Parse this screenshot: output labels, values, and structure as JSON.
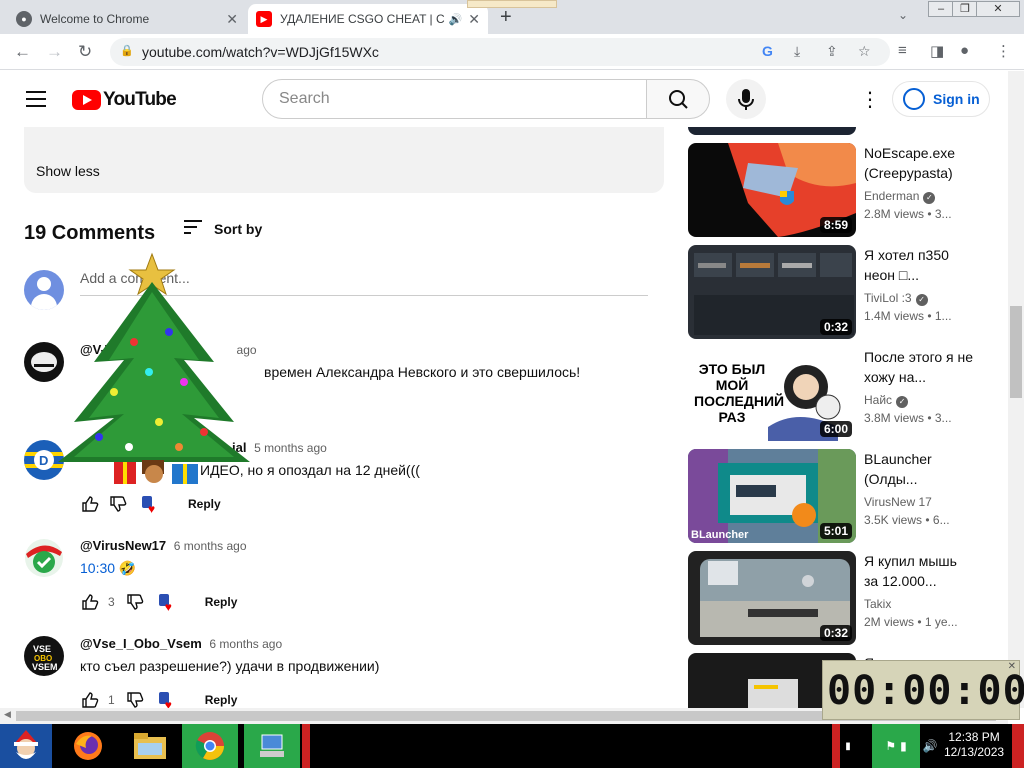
{
  "browser": {
    "tabs": [
      {
        "title": "Welcome to Chrome"
      },
      {
        "title": "УДАЛЕНИЕ CSGO CHEAT | C"
      }
    ],
    "url": "youtube.com/watch?v=WDJjGf15WXc"
  },
  "youtube": {
    "logo_text": "YouTube",
    "search_placeholder": "Search",
    "signin_label": "Sign in"
  },
  "description": {
    "show_less": "Show less"
  },
  "comments": {
    "count_label": "19 Comments",
    "sort_label": "Sort by",
    "add_placeholder": "Add a comment...",
    "reply_label": "Reply",
    "items": [
      {
        "author": "@V-T",
        "time": "ago",
        "text": "времен Александра Невского и это свершилось!",
        "likes": ""
      },
      {
        "author": "ial",
        "time": "5 months ago",
        "text": "ИДЕО, но я опоздал на 12 дней(((",
        "likes": ""
      },
      {
        "author": "@VirusNew17",
        "time": "6 months ago",
        "text": "10:30 🤣",
        "likes": "3"
      },
      {
        "author": "@Vse_I_Obo_Vsem",
        "time": "6 months ago",
        "text": "кто съел разрешение?) удачи в продвижении)",
        "likes": "1"
      }
    ]
  },
  "sidebar": {
    "videos": [
      {
        "title": "NoEscape.exe (Creepypasta)",
        "channel": "Enderman",
        "verified": true,
        "stats": "2.8M views • 3...",
        "duration": "8:59"
      },
      {
        "title": "Я хотел п350 неон □...",
        "channel": "TiviLol :3",
        "verified": true,
        "stats": "1.4M views • 1...",
        "duration": "0:32"
      },
      {
        "title": "После этого я не хожу на...",
        "channel": "Найс",
        "verified": true,
        "stats": "3.8M views • 3...",
        "duration": "6:00",
        "thumb_text": "ЭТО БЫЛ МОЙ ПОСЛЕДНИЙ РАЗ"
      },
      {
        "title": "BLauncher (Олды...",
        "channel": "VirusNew 17",
        "verified": false,
        "stats": "3.5K views • 6...",
        "duration": "5:01",
        "thumb_text": "BLauncher"
      },
      {
        "title": "Я купил мышь за 12.000...",
        "channel": "Takix",
        "verified": false,
        "stats": "2M views • 1 ye...",
        "duration": "0:32"
      },
      {
        "title": "Я ...",
        "channel": "",
        "verified": false,
        "stats": "",
        "duration": ""
      }
    ]
  },
  "clock_widget": {
    "display": "00:00:00"
  },
  "taskbar": {
    "time": "12:38 PM",
    "date": "12/13/2023"
  },
  "colors": {
    "accent": "#065fd4",
    "brand": "#ff0000"
  }
}
